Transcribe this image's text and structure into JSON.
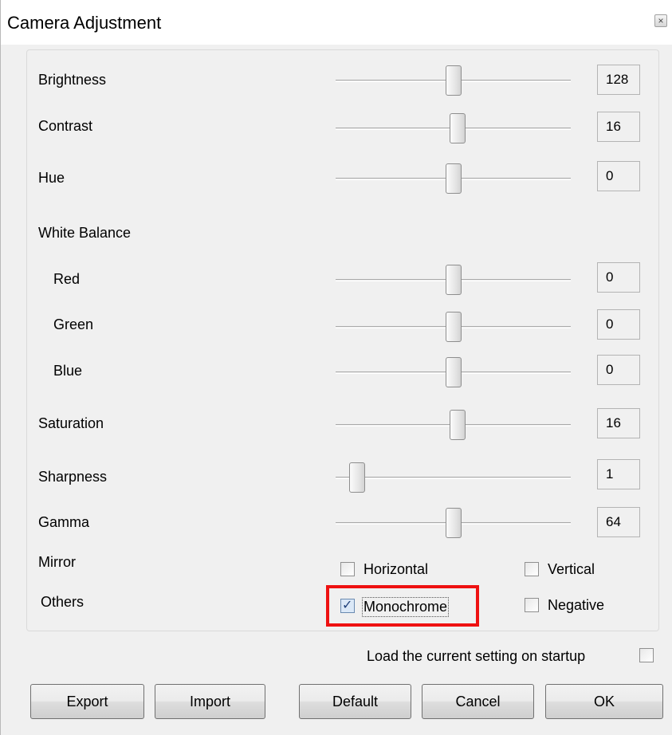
{
  "window": {
    "title": "Camera Adjustment",
    "close_glyph": "×"
  },
  "sliders": [
    {
      "label": "Brightness",
      "value": "128",
      "level": 0.5
    },
    {
      "label": "Contrast",
      "value": "16",
      "level": 0.52
    },
    {
      "label": "Hue",
      "value": "0",
      "level": 0.5
    },
    {
      "label": "Red",
      "value": "0",
      "level": 0.5
    },
    {
      "label": "Green",
      "value": "0",
      "level": 0.5
    },
    {
      "label": "Blue",
      "value": "0",
      "level": 0.5
    },
    {
      "label": "Saturation",
      "value": "16",
      "level": 0.52
    },
    {
      "label": "Sharpness",
      "value": "1",
      "level": 0.09
    },
    {
      "label": "Gamma",
      "value": "64",
      "level": 0.5
    }
  ],
  "white_balance": {
    "label": "White Balance"
  },
  "mirror": {
    "label": "Mirror",
    "horizontal": {
      "label": "Horizontal",
      "checked": false
    },
    "vertical": {
      "label": "Vertical",
      "checked": false
    }
  },
  "others": {
    "label": "Others",
    "monochrome": {
      "label": "Monochrome",
      "checked": true
    },
    "negative": {
      "label": "Negative",
      "checked": false
    }
  },
  "startup": {
    "label": "Load the current setting on startup",
    "checked": false
  },
  "buttons": {
    "export": "Export",
    "import": "Import",
    "default": "Default",
    "cancel": "Cancel",
    "ok": "OK"
  },
  "colors": {
    "highlight": "#ee1111"
  }
}
